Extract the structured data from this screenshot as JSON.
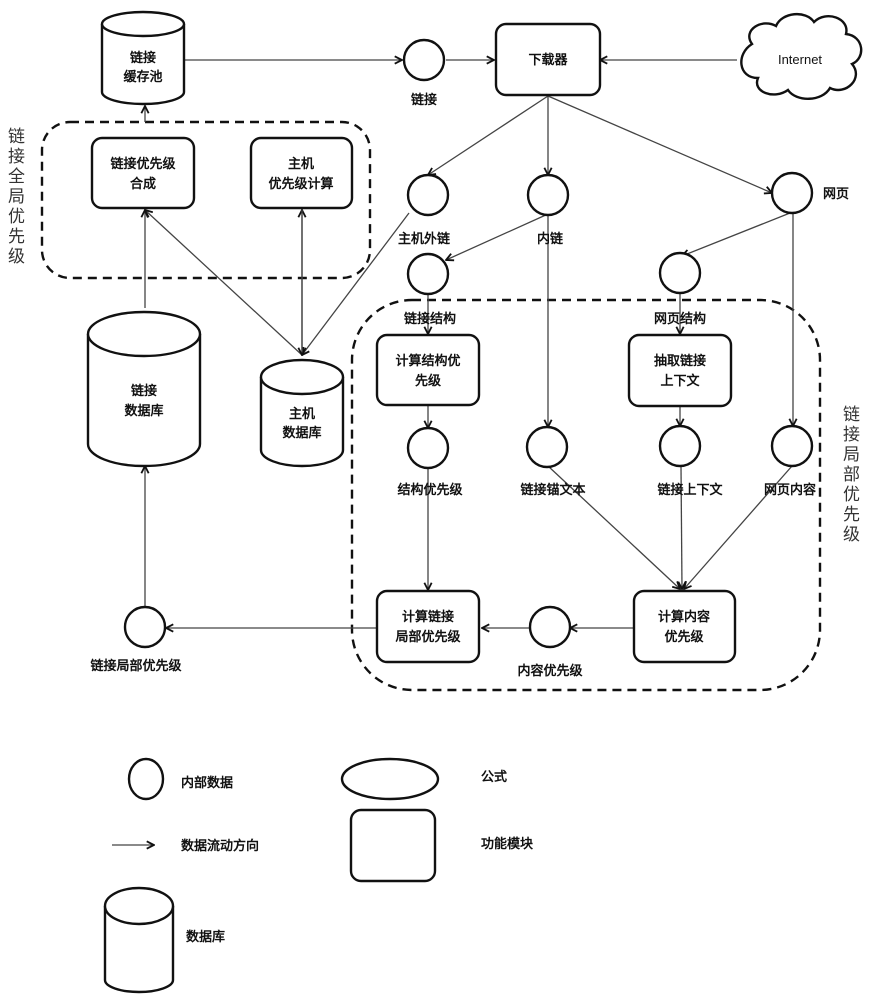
{
  "groups": {
    "global": "链接全局优先级",
    "local": "链接局部优先级"
  },
  "databases": {
    "link_pool": [
      "链接",
      "缓存池"
    ],
    "link_db": [
      "链接",
      "数据库"
    ],
    "host_db": [
      "主机",
      "数据库"
    ]
  },
  "modules": {
    "downloader": [
      "下载器"
    ],
    "link_priority_synthesis": [
      "链接优先级",
      "合成"
    ],
    "host_priority_calc": [
      "主机",
      "优先级计算"
    ],
    "calc_structure_priority": [
      "计算结构优",
      "先级"
    ],
    "extract_link_context": [
      "抽取链接",
      "上下文"
    ],
    "calc_link_local_priority": [
      "计算链接",
      "局部优先级"
    ],
    "calc_content_priority": [
      "计算内容",
      "优先级"
    ]
  },
  "cloud": "Internet",
  "data_nodes": {
    "link": "链接",
    "host_outlink": "主机外链",
    "inner_link": "内链",
    "webpage": "网页",
    "link_structure": "链接结构",
    "page_structure": "网页结构",
    "structure_priority": "结构优先级",
    "anchor_text": "链接锚文本",
    "link_context": "链接上下文",
    "page_content": "网页内容",
    "content_priority": "内容优先级",
    "link_local_priority": "链接局部优先级"
  },
  "legend": {
    "internal_data": "内部数据",
    "data_flow": "数据流动方向",
    "database": "数据库",
    "formula": "公式",
    "function_module": "功能模块"
  }
}
